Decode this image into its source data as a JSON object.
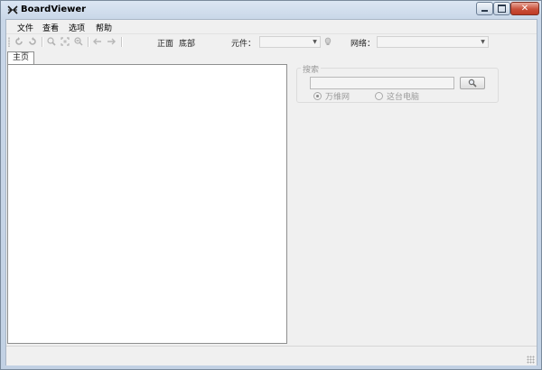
{
  "window": {
    "title": "BoardViewer"
  },
  "menu": {
    "items": [
      "文件",
      "查看",
      "选项",
      "帮助"
    ]
  },
  "toolbar": {
    "view_front": "正面",
    "view_bottom": "底部",
    "component_label": "元件：",
    "component_value": "",
    "net_label": "网络：",
    "net_value": ""
  },
  "tabs": {
    "home": "主页"
  },
  "search": {
    "group_title": "搜索",
    "input_value": "",
    "options": [
      "万维网",
      "这台电脑"
    ],
    "selected_option": "万维网"
  },
  "status": {
    "text": ""
  },
  "icons": {
    "app": "crossed-arrows-icon",
    "search_button": "magnifier-icon",
    "toolbar": [
      "rotate-left-icon",
      "rotate-right-icon",
      "zoom-icon",
      "fit-icon",
      "zoom-out-icon",
      "arrow-left-icon",
      "arrow-right-icon",
      "light-bulb-icon"
    ]
  },
  "colors": {
    "close_button": "#c9503a",
    "title_gradient": "#c9d7e8",
    "client_background": "#f0f0f0"
  }
}
